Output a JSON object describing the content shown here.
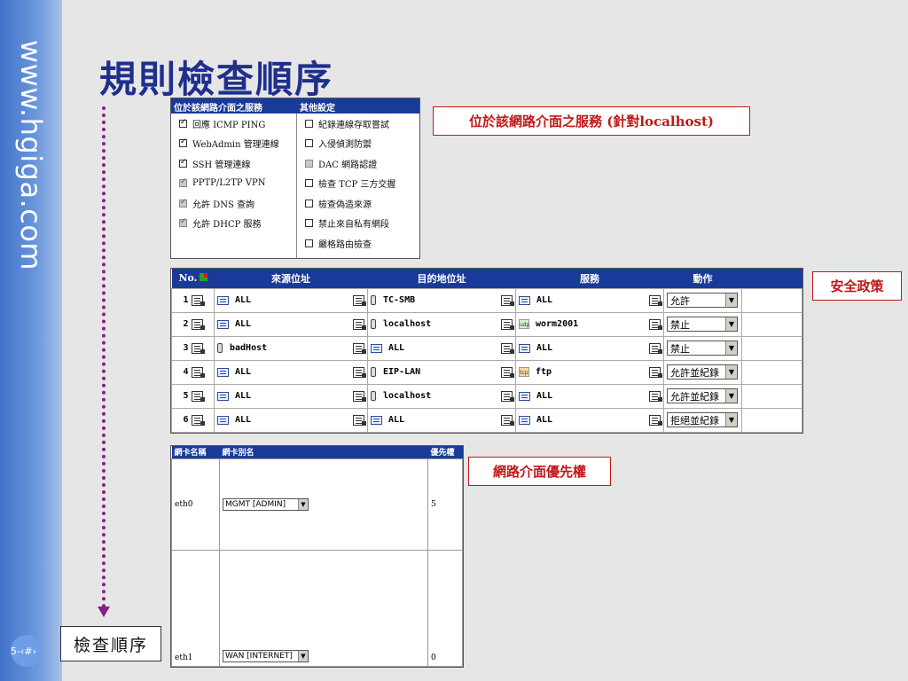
{
  "sidebar": {
    "url": "www.hgiga.com",
    "page_number": "5-‹#›"
  },
  "title": "規則檢查順序",
  "order_label": "檢查順序",
  "callouts": {
    "services": "位於該網路介面之服務 (針對localhost)",
    "policy": "安全政策",
    "nic_priority": "網路介面優先權"
  },
  "services_panel": {
    "header_left": "位於該網路介面之服務",
    "header_right": "其他設定",
    "left_items": [
      {
        "label": "回應 ICMP PING",
        "checked": true,
        "disabled": false
      },
      {
        "label": "WebAdmin 管理連線",
        "checked": true,
        "disabled": false
      },
      {
        "label": "SSH 管理連線",
        "checked": true,
        "disabled": false
      },
      {
        "label": "PPTP/L2TP VPN",
        "checked": true,
        "disabled": true
      },
      {
        "label": "允許 DNS 查詢",
        "checked": true,
        "disabled": true
      },
      {
        "label": "允許 DHCP 服務",
        "checked": true,
        "disabled": true
      }
    ],
    "right_items": [
      {
        "label": "紀錄連線存取嘗試",
        "checked": false,
        "disabled": false
      },
      {
        "label": "入侵偵測防禦",
        "checked": false,
        "disabled": false
      },
      {
        "label": "DAC 網路認證",
        "checked": false,
        "disabled": true
      },
      {
        "label": "檢查 TCP 三方交握",
        "checked": false,
        "disabled": false
      },
      {
        "label": "檢查偽造來源",
        "checked": false,
        "disabled": false
      },
      {
        "label": "禁止來自私有網段",
        "checked": false,
        "disabled": false
      },
      {
        "label": "嚴格路由檢查",
        "checked": false,
        "disabled": false
      }
    ]
  },
  "policy_table": {
    "headers": [
      "No.",
      "來源位址",
      "目的地位址",
      "服務",
      "動作"
    ],
    "rows": [
      {
        "no": "1",
        "src": "ALL",
        "src_icon": "net",
        "dst": "TC-SMB",
        "dst_icon": "host",
        "svc": "ALL",
        "svc_icon": "net",
        "action": "允許"
      },
      {
        "no": "2",
        "src": "ALL",
        "src_icon": "net",
        "dst": "localhost",
        "dst_icon": "host",
        "svc": "worm2001",
        "svc_icon": "udp",
        "action": "禁止"
      },
      {
        "no": "3",
        "src": "badHost",
        "src_icon": "host",
        "dst": "ALL",
        "dst_icon": "net",
        "svc": "ALL",
        "svc_icon": "net",
        "action": "禁止"
      },
      {
        "no": "4",
        "src": "ALL",
        "src_icon": "net",
        "dst": "EIP-LAN",
        "dst_icon": "host",
        "svc": "ftp",
        "svc_icon": "tcp",
        "action": "允許並紀錄"
      },
      {
        "no": "5",
        "src": "ALL",
        "src_icon": "net",
        "dst": "localhost",
        "dst_icon": "host",
        "svc": "ALL",
        "svc_icon": "net",
        "action": "允許並紀錄"
      },
      {
        "no": "6",
        "src": "ALL",
        "src_icon": "net",
        "dst": "ALL",
        "dst_icon": "net",
        "svc": "ALL",
        "svc_icon": "net",
        "action": "拒絕並紀錄"
      }
    ],
    "proto_labels": {
      "udp": "udp",
      "tcp": "tcp"
    }
  },
  "nic_table": {
    "headers": [
      "網卡名稱",
      "網卡別名",
      "優先權"
    ],
    "rows": [
      {
        "name": "eth0",
        "alias": "MGMT [ADMIN]",
        "priority": "5"
      },
      {
        "name": "eth1",
        "alias": "WAN [INTERNET]",
        "priority": "0"
      }
    ]
  },
  "colors": {
    "accent": "#1a3a9a",
    "title": "#1f2f8c",
    "callout": "#c01818",
    "arrow": "#8c1b8c"
  }
}
